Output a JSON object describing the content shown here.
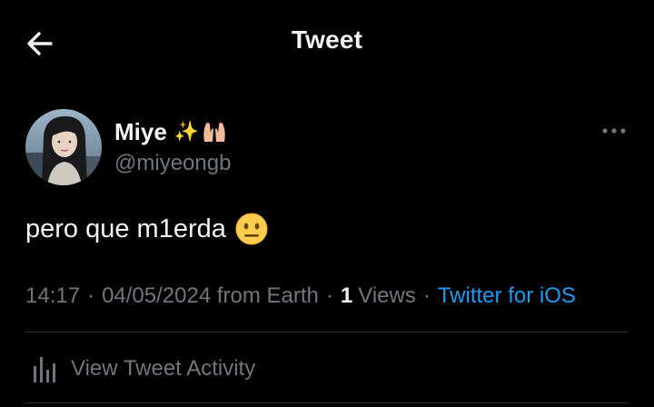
{
  "header": {
    "title": "Tweet",
    "back_icon": "arrow-left-icon"
  },
  "author": {
    "display_name": "Miye",
    "name_emoji": "✨",
    "name_emoji_2_icon": "raising-hands-icon",
    "handle": "@miyeongb",
    "more_icon": "more-horizontal-icon"
  },
  "tweet": {
    "text": "pero que m1erda",
    "emoji_icon": "neutral-face-icon"
  },
  "meta": {
    "time": "14:17",
    "separator": "·",
    "date": "04/05/2024 from Earth",
    "views_count": "1",
    "views_label": "Views",
    "client": "Twitter for iOS"
  },
  "activity": {
    "label": "View Tweet Activity",
    "icon": "analytics-bars-icon"
  },
  "colors": {
    "background": "#000000",
    "text_primary": "#f2f4f5",
    "text_secondary": "#71767b",
    "link": "#1d9bf0",
    "divider": "#2f3336"
  }
}
